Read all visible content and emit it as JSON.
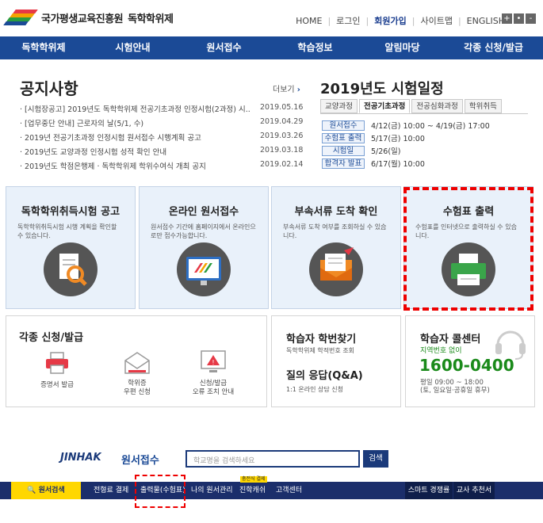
{
  "header": {
    "org_name": "국가평생교육진흥원",
    "site_name": "독학학위제",
    "util_links": [
      "HOME",
      "로그인",
      "회원가입",
      "사이트맵",
      "ENGLISH"
    ],
    "font_controls": [
      "+",
      "•",
      "-"
    ]
  },
  "gnb": [
    "독학학위제",
    "시험안내",
    "원서접수",
    "학습정보",
    "알림마당",
    "각종 신청/발급"
  ],
  "notice": {
    "title": "공지사항",
    "more": "더보기",
    "items": [
      {
        "title": "[시험장공고] 2019년도 독학학위제 전공기초과정 인정시험(2과정) 시...",
        "date": "2019.05.16"
      },
      {
        "title": "[업무중단 안내] 근로자의 날(5/1, 수)",
        "date": "2019.04.29"
      },
      {
        "title": "2019년 전공기초과정 인정시험 원서접수 시행계획 공고",
        "date": "2019.03.26"
      },
      {
        "title": "2019년도 교양과정 인정시험 성적 확인 안내",
        "date": "2019.03.18"
      },
      {
        "title": "2019년도 학점은행제 · 독학학위제 학위수여식 개최 공지",
        "date": "2019.02.14"
      }
    ]
  },
  "schedule": {
    "title": "2019년도 시험일정",
    "tabs": [
      "교양과정",
      "전공기초과정",
      "전공심화과정",
      "학위취득"
    ],
    "rows": [
      {
        "k": "원서접수",
        "v": "4/12(금) 10:00 ~ 4/19(금) 17:00"
      },
      {
        "k": "수험표 출력",
        "v": "5/17(금) 10:00"
      },
      {
        "k": "시험일",
        "v": "5/26(일)"
      },
      {
        "k": "합격자 발표",
        "v": "6/17(월) 10:00"
      }
    ]
  },
  "cards": [
    {
      "title": "독학학위취득시험 공고",
      "desc": "독학학위취득시험 시행 계획을 확인할 수 있습니다."
    },
    {
      "title": "온라인 원서접수",
      "desc": "원서접수 기간에 홈페이지에서 온라인으로만 접수가능합니다."
    },
    {
      "title": "부속서류 도착 확인",
      "desc": "부속서류 도착 여부를 조회하실 수 있습니다."
    },
    {
      "title": "수험표 출력",
      "desc": "수험표를 인터넷으로 출력하실 수 있습니다."
    }
  ],
  "apply": {
    "title": "각종 신청/발급",
    "items": [
      "증명서 발급",
      "학위증\n우편 신청",
      "신청/발급\n오류 조치 안내"
    ]
  },
  "student": {
    "title": "학습자 학번찾기",
    "desc": "독학학위제 학적번호 조회",
    "qa_title": "질의 응답(Q&A)",
    "qa_desc": "1:1 온라인 상담 신청"
  },
  "call": {
    "title": "학습자 콜센터",
    "sub": "지역번호 없이",
    "number": "1600-0400",
    "hours": "평일 09:00 ~ 18:00\n(토, 일요일·공휴일 휴무)"
  },
  "jinhak": {
    "logo": "JINHAK",
    "service": "원서접수",
    "search_placeholder": "학교명을 검색하세요",
    "search_btn": "검색",
    "menu": [
      "원서검색",
      "전형료 결제",
      "출력물(수험표)",
      "나의 원서관리",
      "진학캐쉬",
      "고객센터",
      "스마트 경쟁률",
      "교사 추천서"
    ],
    "badge": "충전식 결제"
  },
  "colors": {
    "primary": "#1b4a96",
    "jinhak_bar": "#1b2e6b",
    "highlight": "#e00000",
    "card_bg": "#e9f1fa",
    "call_green": "#1a8a1a"
  }
}
